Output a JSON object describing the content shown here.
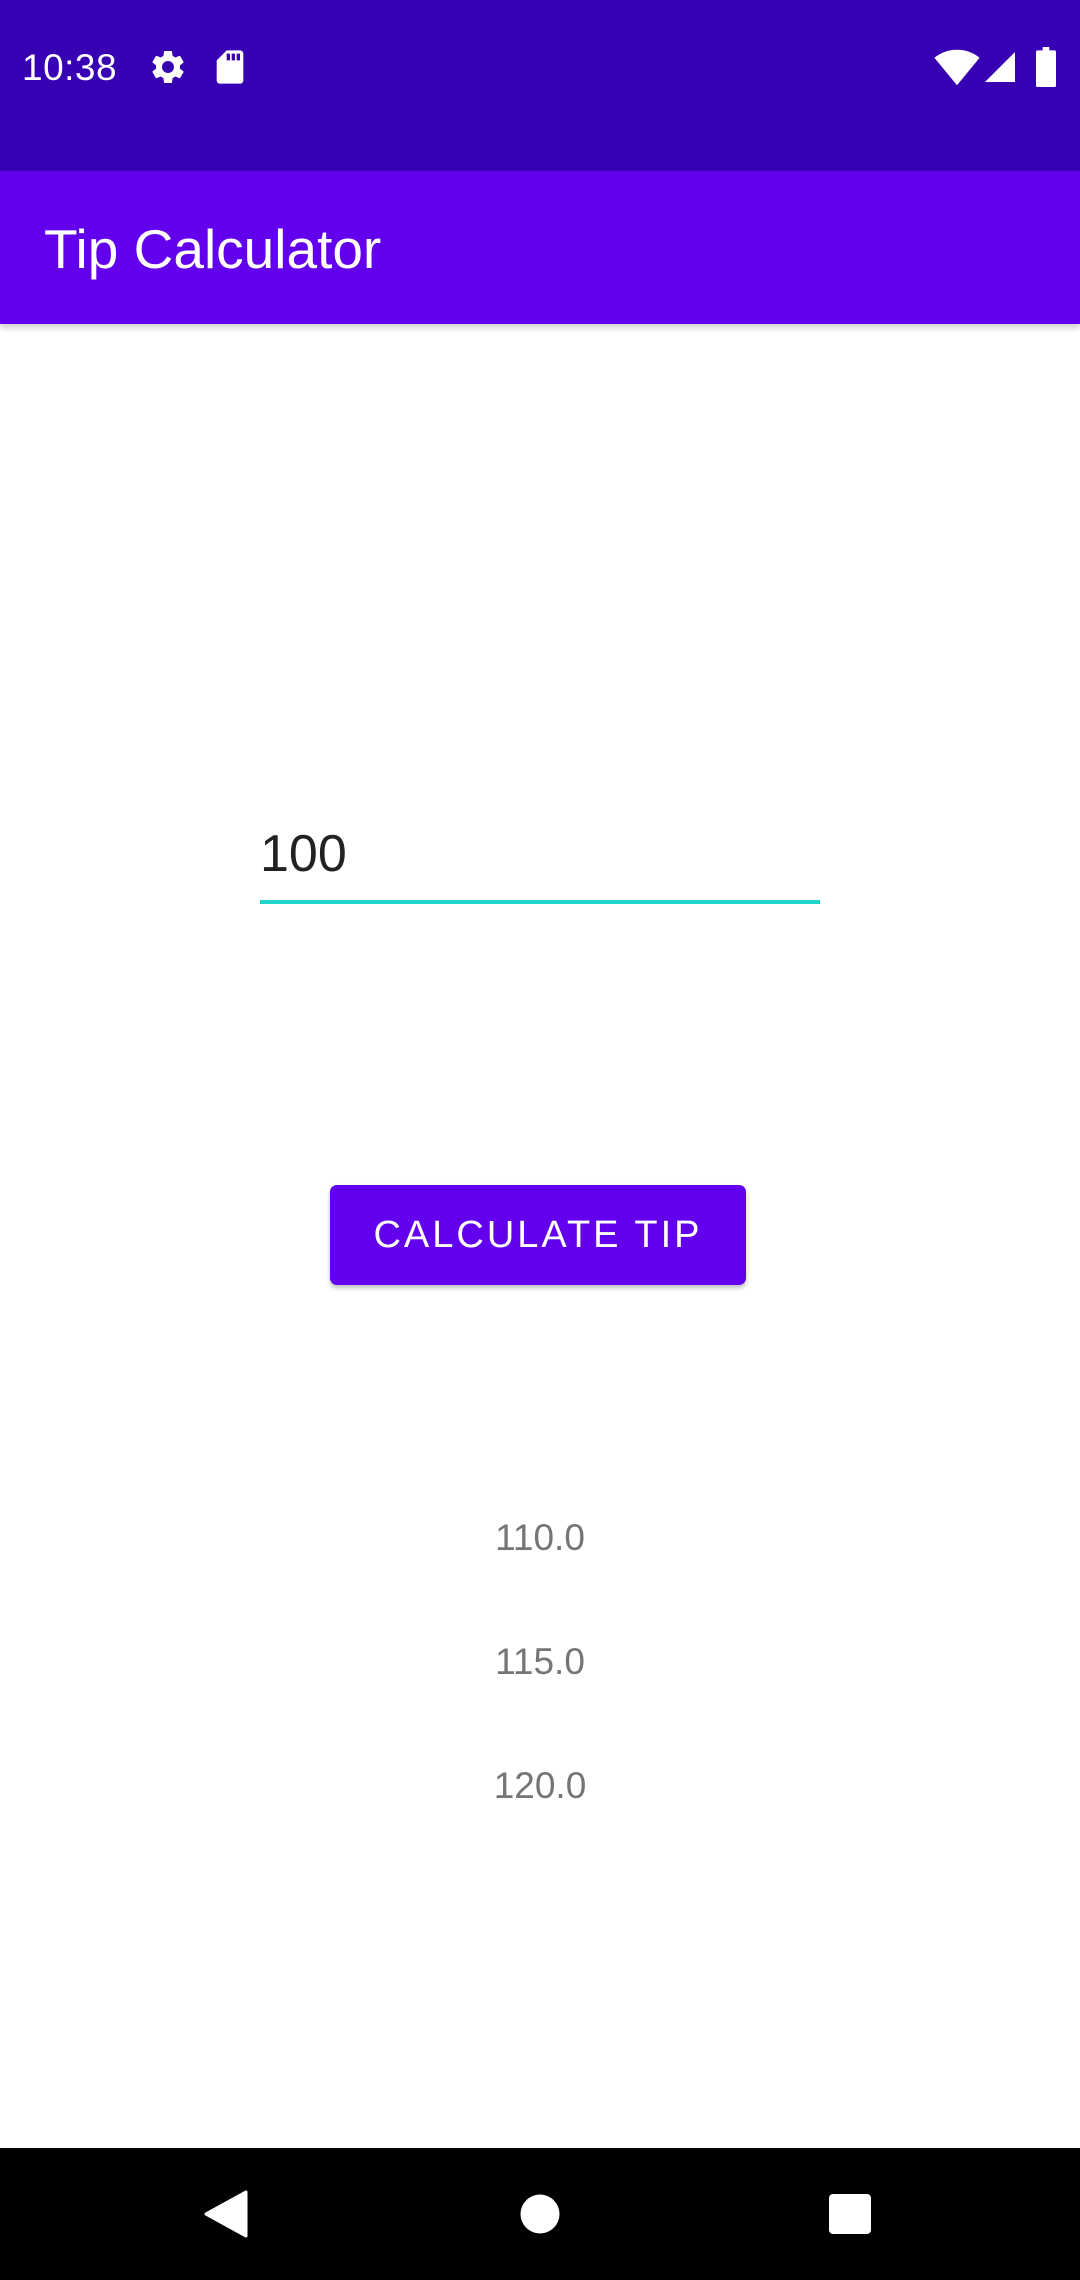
{
  "status_bar": {
    "time": "10:38",
    "icons": [
      "gear-icon",
      "sd-card-icon",
      "wifi-icon",
      "signal-icon",
      "battery-icon"
    ],
    "background_color": "#3700b3"
  },
  "app_bar": {
    "title": "Tip Calculator",
    "background_color": "#6200ee"
  },
  "form": {
    "amount_value": "100",
    "underline_color": "#1fd6c8",
    "calculate_button_label": "CALCULATE TIP",
    "button_color": "#6200ee"
  },
  "results": [
    {
      "label": "110.0"
    },
    {
      "label": "115.0"
    },
    {
      "label": "120.0"
    }
  ],
  "navigation_bar": {
    "buttons": [
      "back-icon",
      "home-icon",
      "recents-icon"
    ]
  }
}
